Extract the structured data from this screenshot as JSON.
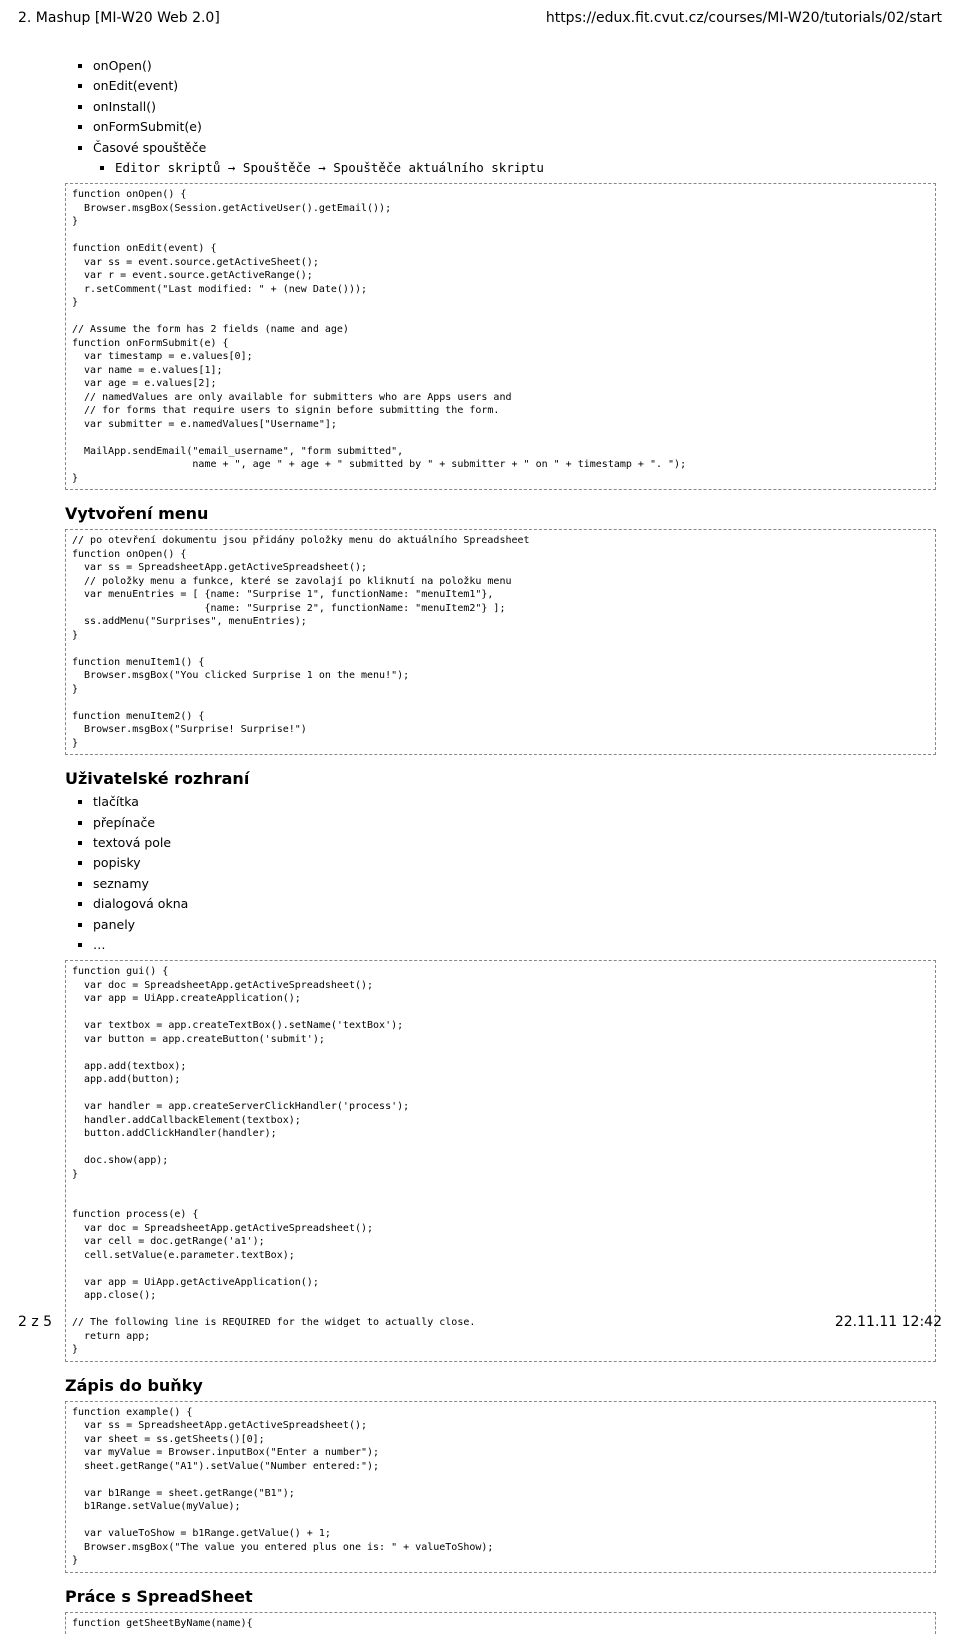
{
  "header": {
    "left": "2. Mashup [MI-W20 Web 2.0]",
    "right": "https://edux.fit.cvut.cz/courses/MI-W20/tutorials/02/start"
  },
  "footer": {
    "left": "2 z 5",
    "right": "22.11.11 12:42"
  },
  "list_triggers": {
    "items": [
      "onOpen()",
      "onEdit(event)",
      "onInstall()",
      "onFormSubmit(e)",
      "Časové spouštěče"
    ],
    "sub": "Editor skriptů → Spouštěče → Spouštěče aktuálního skriptu"
  },
  "code1": "function onOpen() {\n  Browser.msgBox(Session.getActiveUser().getEmail());\n}\n\nfunction onEdit(event) {\n  var ss = event.source.getActiveSheet();\n  var r = event.source.getActiveRange();\n  r.setComment(\"Last modified: \" + (new Date()));\n}\n\n// Assume the form has 2 fields (name and age)\nfunction onFormSubmit(e) {\n  var timestamp = e.values[0];\n  var name = e.values[1];\n  var age = e.values[2];\n  // namedValues are only available for submitters who are Apps users and\n  // for forms that require users to signin before submitting the form.\n  var submitter = e.namedValues[\"Username\"];\n\n  MailApp.sendEmail(\"email_username\", \"form submitted\",\n                    name + \", age \" + age + \" submitted by \" + submitter + \" on \" + timestamp + \". \");\n}",
  "sect_menu": "Vytvoření menu",
  "code2": "// po otevření dokumentu jsou přidány položky menu do aktuálního Spreadsheet\nfunction onOpen() {\n  var ss = SpreadsheetApp.getActiveSpreadsheet();\n  // položky menu a funkce, které se zavolají po kliknutí na položku menu\n  var menuEntries = [ {name: \"Surprise 1\", functionName: \"menuItem1\"},\n                      {name: \"Surprise 2\", functionName: \"menuItem2\"} ];\n  ss.addMenu(\"Surprises\", menuEntries);\n}\n\nfunction menuItem1() {\n  Browser.msgBox(\"You clicked Surprise 1 on the menu!\");\n}\n\nfunction menuItem2() {\n  Browser.msgBox(\"Surprise! Surprise!\")\n}",
  "sect_ui": "Uživatelské rozhraní",
  "list_ui": [
    "tlačítka",
    "přepínače",
    "textová pole",
    "popisky",
    "seznamy",
    "dialogová okna",
    "panely",
    "…"
  ],
  "code3": "function gui() {\n  var doc = SpreadsheetApp.getActiveSpreadsheet();\n  var app = UiApp.createApplication();\n\n  var textbox = app.createTextBox().setName('textBox');\n  var button = app.createButton('submit');\n\n  app.add(textbox);\n  app.add(button);\n\n  var handler = app.createServerClickHandler('process');\n  handler.addCallbackElement(textbox);\n  button.addClickHandler(handler);\n\n  doc.show(app);\n}\n\n\nfunction process(e) {\n  var doc = SpreadsheetApp.getActiveSpreadsheet();\n  var cell = doc.getRange('a1');\n  cell.setValue(e.parameter.textBox);\n\n  var app = UiApp.getActiveApplication();\n  app.close();\n\n// The following line is REQUIRED for the widget to actually close.\n  return app;\n}",
  "sect_cell": "Zápis do buňky",
  "code4": "function example() {\n  var ss = SpreadsheetApp.getActiveSpreadsheet();\n  var sheet = ss.getSheets()[0];\n  var myValue = Browser.inputBox(\"Enter a number\");\n  sheet.getRange(\"A1\").setValue(\"Number entered:\");\n\n  var b1Range = sheet.getRange(\"B1\");\n  b1Range.setValue(myValue);\n\n  var valueToShow = b1Range.getValue() + 1;\n  Browser.msgBox(\"The value you entered plus one is: \" + valueToShow);\n}",
  "sect_spread": "Práce s SpreadSheet",
  "code5": "function getSheetByName(name){"
}
